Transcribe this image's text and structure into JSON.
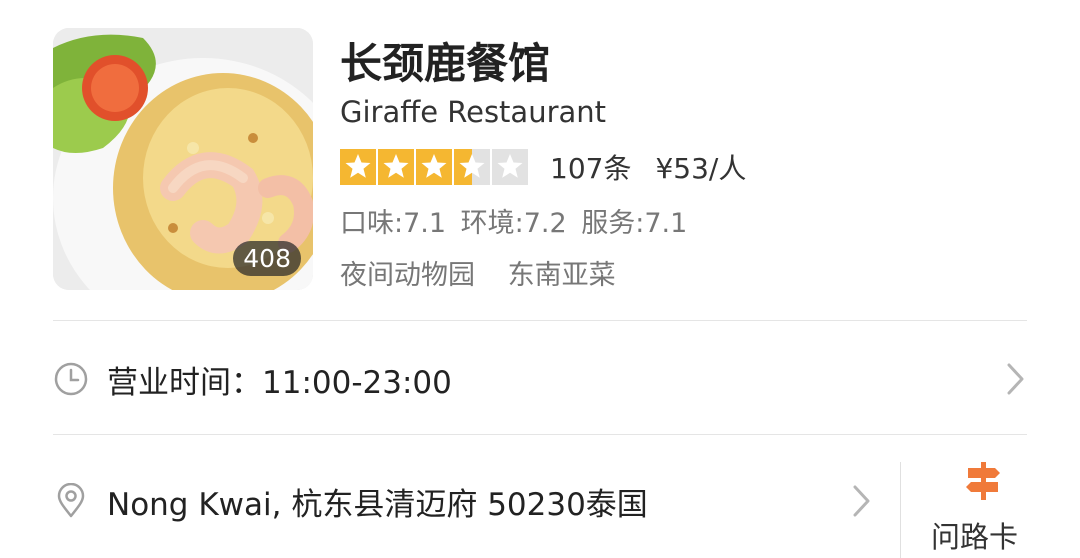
{
  "restaurant": {
    "name_cn": "长颈鹿餐馆",
    "name_en": "Giraffe Restaurant",
    "photo_count": "408",
    "rating_stars": 3.5,
    "reviews": "107条",
    "price": "¥53/人",
    "scores": {
      "taste": "口味:7.1",
      "environment": "环境:7.2",
      "service": "服务:7.1"
    },
    "tags": [
      "夜间动物园",
      "东南亚菜"
    ]
  },
  "hours": {
    "text": "营业时间：11:00-23:00"
  },
  "address": {
    "text": "Nong Kwai, 杭东县清迈府 50230泰国"
  },
  "route_card": {
    "label": "问路卡"
  },
  "colors": {
    "star_active": "#f5b731",
    "star_inactive": "#e2e2e2",
    "route_icon": "#f07a3a",
    "icon_gray": "#a0a0a0"
  }
}
